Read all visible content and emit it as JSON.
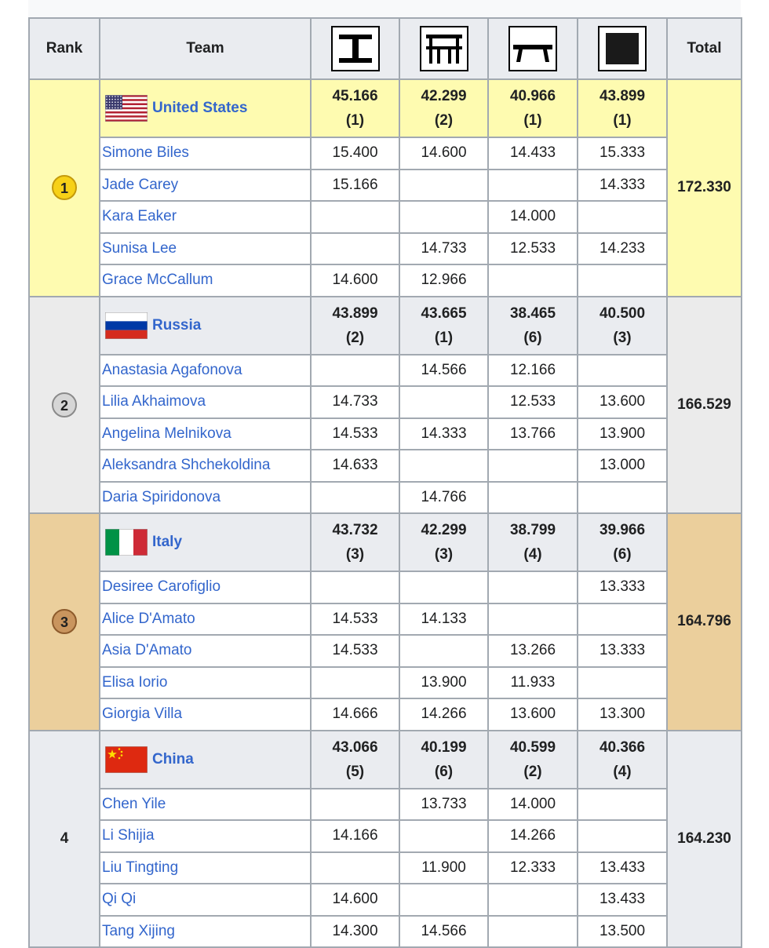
{
  "header": {
    "rank": "Rank",
    "team": "Team",
    "total": "Total",
    "apparatus_icons": [
      "uneven-bars-icon",
      "vault-icon",
      "balance-beam-icon",
      "floor-icon"
    ]
  },
  "colors": {
    "gold_row": "#fefbb0",
    "silver_row": "#ebebeb",
    "bronze_row": "#ebcf9c",
    "link": "#3366cc",
    "header_bg": "#eaecf0",
    "border": "#a2a9b1"
  },
  "teams": [
    {
      "rank": "1",
      "medal": "gold",
      "name": "United States",
      "flag": "usa-flag-icon",
      "totals": [
        {
          "score": "45.166",
          "place": "(1)"
        },
        {
          "score": "42.299",
          "place": "(2)"
        },
        {
          "score": "40.966",
          "place": "(1)"
        },
        {
          "score": "43.899",
          "place": "(1)"
        }
      ],
      "total": "172.330",
      "athletes": [
        {
          "name": "Simone Biles",
          "scores": [
            "15.400",
            "14.600",
            "14.433",
            "15.333"
          ]
        },
        {
          "name": "Jade Carey",
          "scores": [
            "15.166",
            "",
            "",
            "14.333"
          ]
        },
        {
          "name": "Kara Eaker",
          "scores": [
            "",
            "",
            "14.000",
            ""
          ]
        },
        {
          "name": "Sunisa Lee",
          "scores": [
            "",
            "14.733",
            "12.533",
            "14.233"
          ]
        },
        {
          "name": "Grace McCallum",
          "scores": [
            "14.600",
            "12.966",
            "",
            ""
          ]
        }
      ]
    },
    {
      "rank": "2",
      "medal": "silver",
      "name": "Russia",
      "flag": "russia-flag-icon",
      "totals": [
        {
          "score": "43.899",
          "place": "(2)"
        },
        {
          "score": "43.665",
          "place": "(1)"
        },
        {
          "score": "38.465",
          "place": "(6)"
        },
        {
          "score": "40.500",
          "place": "(3)"
        }
      ],
      "total": "166.529",
      "athletes": [
        {
          "name": "Anastasia Agafonova",
          "scores": [
            "",
            "14.566",
            "12.166",
            ""
          ]
        },
        {
          "name": "Lilia Akhaimova",
          "scores": [
            "14.733",
            "",
            "12.533",
            "13.600"
          ]
        },
        {
          "name": "Angelina Melnikova",
          "scores": [
            "14.533",
            "14.333",
            "13.766",
            "13.900"
          ]
        },
        {
          "name": "Aleksandra Shchekoldina",
          "scores": [
            "14.633",
            "",
            "",
            "13.000"
          ]
        },
        {
          "name": "Daria Spiridonova",
          "scores": [
            "",
            "14.766",
            "",
            ""
          ]
        }
      ]
    },
    {
      "rank": "3",
      "medal": "bronze",
      "name": "Italy",
      "flag": "italy-flag-icon",
      "totals": [
        {
          "score": "43.732",
          "place": "(3)"
        },
        {
          "score": "42.299",
          "place": "(3)"
        },
        {
          "score": "38.799",
          "place": "(4)"
        },
        {
          "score": "39.966",
          "place": "(6)"
        }
      ],
      "total": "164.796",
      "athletes": [
        {
          "name": "Desiree Carofiglio",
          "scores": [
            "",
            "",
            "",
            "13.333"
          ]
        },
        {
          "name": "Alice D'Amato",
          "scores": [
            "14.533",
            "14.133",
            "",
            ""
          ]
        },
        {
          "name": "Asia D'Amato",
          "scores": [
            "14.533",
            "",
            "13.266",
            "13.333"
          ]
        },
        {
          "name": "Elisa Iorio",
          "scores": [
            "",
            "13.900",
            "11.933",
            ""
          ]
        },
        {
          "name": "Giorgia Villa",
          "scores": [
            "14.666",
            "14.266",
            "13.600",
            "13.300"
          ]
        }
      ]
    },
    {
      "rank": "4",
      "medal": "",
      "name": "China",
      "flag": "china-flag-icon",
      "totals": [
        {
          "score": "43.066",
          "place": "(5)"
        },
        {
          "score": "40.199",
          "place": "(6)"
        },
        {
          "score": "40.599",
          "place": "(2)"
        },
        {
          "score": "40.366",
          "place": "(4)"
        }
      ],
      "total": "164.230",
      "athletes": [
        {
          "name": "Chen Yile",
          "scores": [
            "",
            "13.733",
            "14.000",
            ""
          ]
        },
        {
          "name": "Li Shijia",
          "scores": [
            "14.166",
            "",
            "14.266",
            ""
          ]
        },
        {
          "name": "Liu Tingting",
          "scores": [
            "",
            "11.900",
            "12.333",
            "13.433"
          ]
        },
        {
          "name": "Qi Qi",
          "scores": [
            "14.600",
            "",
            "",
            "13.433"
          ]
        },
        {
          "name": "Tang Xijing",
          "scores": [
            "14.300",
            "14.566",
            "",
            "13.500"
          ]
        }
      ]
    }
  ]
}
